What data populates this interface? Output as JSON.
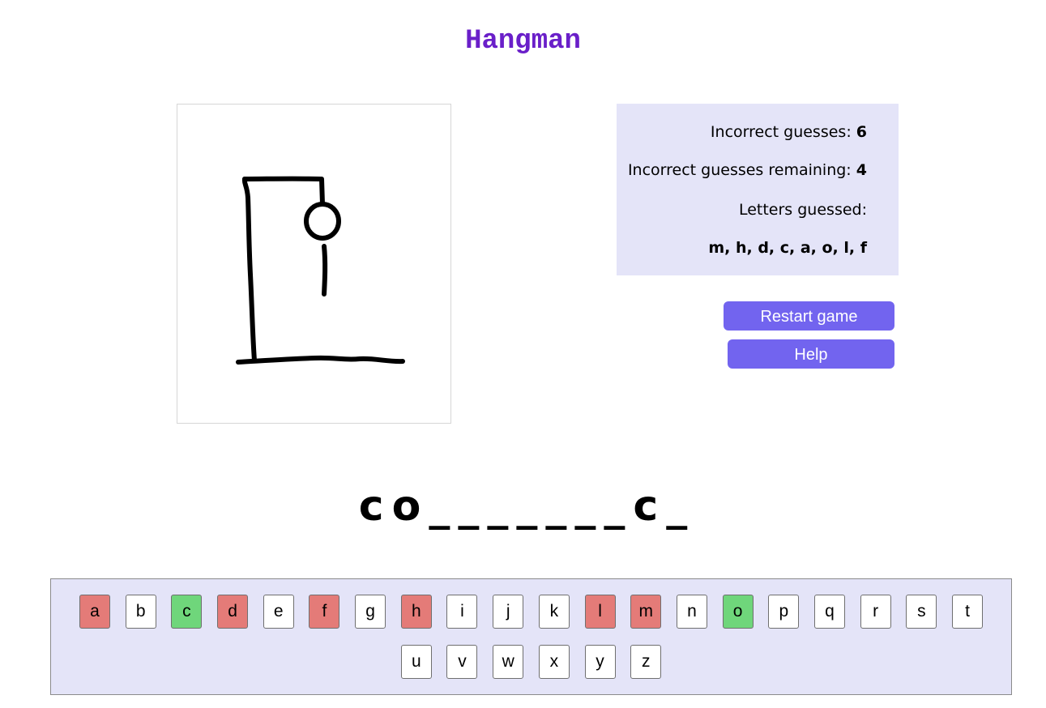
{
  "app": {
    "title": "Hangman"
  },
  "stats": {
    "incorrect_label": "Incorrect guesses:",
    "incorrect_value": "6",
    "remaining_label": "Incorrect guesses remaining:",
    "remaining_value": "4",
    "letters_label": "Letters guessed:",
    "letters_value": "m, h, d, c, a, o, l, f"
  },
  "buttons": {
    "restart_label": "Restart game",
    "help_label": "Help"
  },
  "word": [
    "c",
    "o",
    "_",
    "_",
    "_",
    "_",
    "_",
    "_",
    "_",
    "c",
    "_"
  ],
  "keyboard": {
    "row1": [
      {
        "letter": "a",
        "state": "wrong"
      },
      {
        "letter": "b",
        "state": "none"
      },
      {
        "letter": "c",
        "state": "right"
      },
      {
        "letter": "d",
        "state": "wrong"
      },
      {
        "letter": "e",
        "state": "none"
      },
      {
        "letter": "f",
        "state": "wrong"
      },
      {
        "letter": "g",
        "state": "none"
      },
      {
        "letter": "h",
        "state": "wrong"
      },
      {
        "letter": "i",
        "state": "none"
      },
      {
        "letter": "j",
        "state": "none"
      },
      {
        "letter": "k",
        "state": "none"
      },
      {
        "letter": "l",
        "state": "wrong"
      },
      {
        "letter": "m",
        "state": "wrong"
      },
      {
        "letter": "n",
        "state": "none"
      },
      {
        "letter": "o",
        "state": "right"
      },
      {
        "letter": "p",
        "state": "none"
      },
      {
        "letter": "q",
        "state": "none"
      },
      {
        "letter": "r",
        "state": "none"
      },
      {
        "letter": "s",
        "state": "none"
      },
      {
        "letter": "t",
        "state": "none"
      }
    ],
    "row2": [
      {
        "letter": "u",
        "state": "none"
      },
      {
        "letter": "v",
        "state": "none"
      },
      {
        "letter": "w",
        "state": "none"
      },
      {
        "letter": "x",
        "state": "none"
      },
      {
        "letter": "y",
        "state": "none"
      },
      {
        "letter": "z",
        "state": "none"
      }
    ]
  },
  "colors": {
    "title": "#6a1fc9",
    "panel": "#e4e4f8",
    "button": "#7264ef",
    "wrong_key": "#e47b78",
    "right_key": "#6fd67b"
  }
}
